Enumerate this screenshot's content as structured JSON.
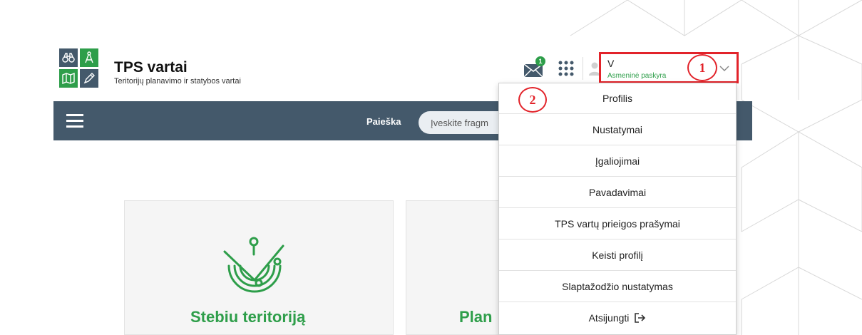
{
  "brand": {
    "title": "TPS vartai",
    "subtitle": "Teritorijų planavimo ir statybos vartai"
  },
  "header": {
    "mail_badge": "1",
    "user_name": "V",
    "user_subtitle": "Asmeninė paskyra"
  },
  "annotations": {
    "step1": "1",
    "step2": "2"
  },
  "nav": {
    "search_label": "Paieška",
    "search_placeholder": "Įveskite fragm"
  },
  "dropdown": {
    "items": [
      "Profilis",
      "Nustatymai",
      "Įgaliojimai",
      "Pavadavimai",
      "TPS vartų prieigos prašymai",
      "Keisti profilį",
      "Slaptažodžio nustatymas",
      "Atsijungti"
    ]
  },
  "cards": {
    "card1_title": "Stebiu teritoriją",
    "card2_title": "Plan"
  },
  "colors": {
    "brand_green": "#2e9e4a",
    "navbar": "#44596b",
    "annotation_red": "#e2232a"
  },
  "icons": {
    "logo": [
      "binoculars-icon",
      "compass-icon",
      "map-icon",
      "pen-icon"
    ],
    "header": [
      "mail-icon",
      "apps-grid-icon",
      "user-icon",
      "chevron-down-icon"
    ],
    "menu": "hamburger-icon",
    "logout": "logout-icon",
    "card1": "radar-icon"
  }
}
